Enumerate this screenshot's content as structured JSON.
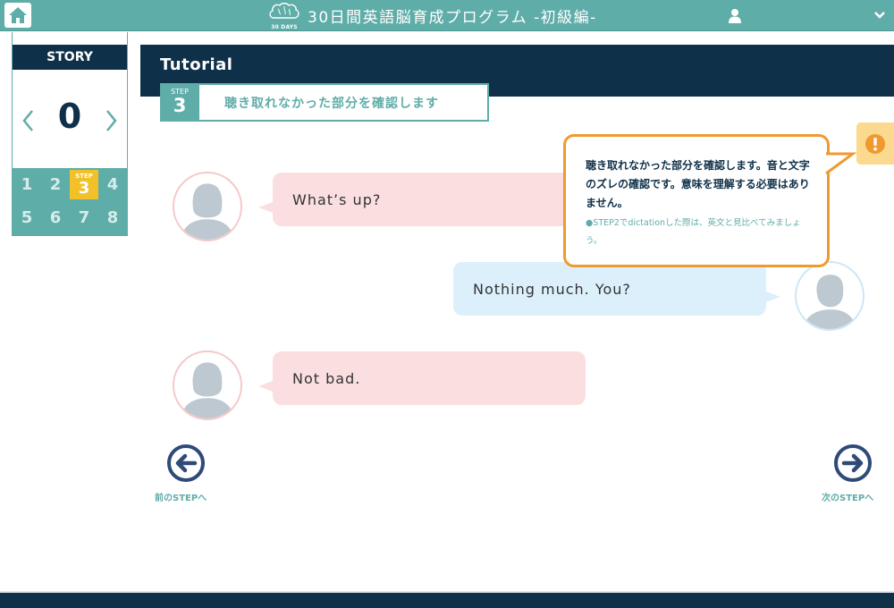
{
  "header": {
    "title": "30日間英語脳育成プログラム -初級編-",
    "logo_text": "30 DAYS",
    "icons": {
      "home": "home-icon",
      "user": "user-icon",
      "menu": "chevron-down-icon",
      "logo": "brain-icon"
    }
  },
  "story": {
    "label": "STORY",
    "number": "0",
    "steps": [
      "1",
      "2",
      "3",
      "4",
      "5",
      "6",
      "7",
      "8"
    ],
    "current_step_label": "STEP",
    "current_step": "3"
  },
  "main": {
    "title": "Tutorial",
    "step_badge_label": "STEP",
    "step_badge_number": "3",
    "step_heading": "聴き取れなかった部分を確認します"
  },
  "dialogue": [
    {
      "speaker": "female",
      "side": "left",
      "text": "What’s  up?"
    },
    {
      "speaker": "male",
      "side": "right",
      "text": "Nothing  much.  You?"
    },
    {
      "speaker": "female",
      "side": "left",
      "text": "Not  bad."
    }
  ],
  "tooltip": {
    "main_text": "聴き取れなかった部分を確認します。音と文字のズレの確認です。意味を理解する必要はありません。",
    "note": "●STEP2でdictationした際は、英文と見比べてみましょう。"
  },
  "navigation": {
    "prev_label": "前のSTEPへ",
    "next_label": "次のSTEPへ"
  },
  "colors": {
    "teal": "#5fada8",
    "navy": "#0f3049",
    "accent_yellow": "#f2c029",
    "tooltip_orange": "#f0992f",
    "bubble_pink": "#fbdfe0",
    "bubble_blue": "#dcf0fb"
  }
}
